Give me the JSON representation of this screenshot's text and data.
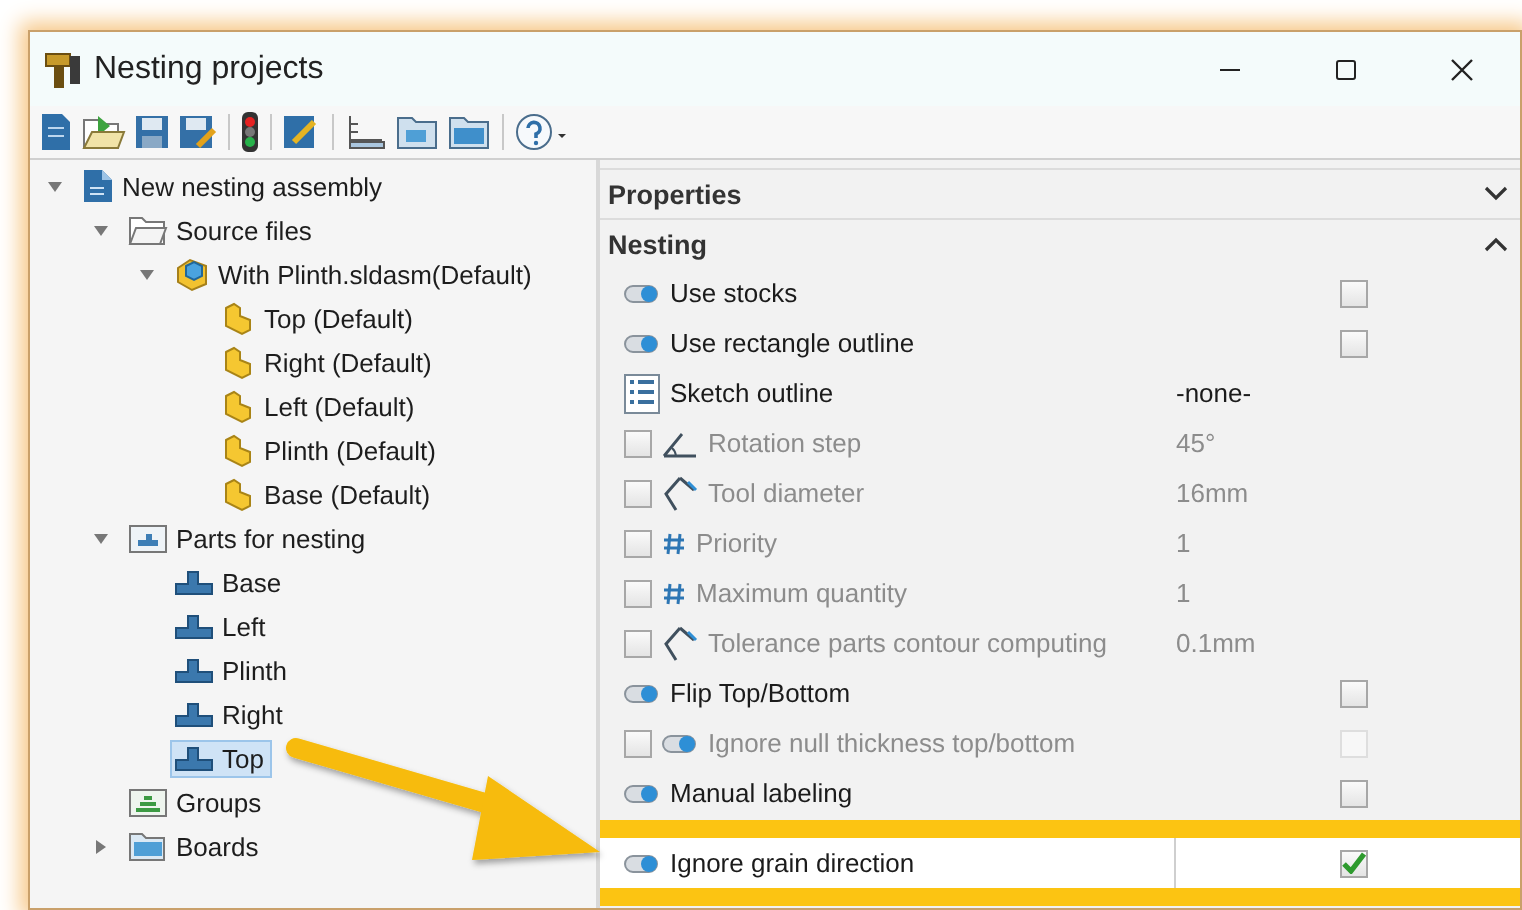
{
  "window": {
    "title": "Nesting projects"
  },
  "tree": [
    {
      "label": "New nesting assembly",
      "kind": "document",
      "expanded": true,
      "selected": false,
      "children": [
        {
          "label": "Source files",
          "kind": "folder",
          "expanded": true,
          "selected": false,
          "children": [
            {
              "label": "With Plinth.sldasm(Default)",
              "kind": "assembly",
              "expanded": true,
              "selected": false,
              "children": [
                {
                  "label": "Top (Default)",
                  "kind": "part",
                  "selected": false
                },
                {
                  "label": "Right (Default)",
                  "kind": "part",
                  "selected": false
                },
                {
                  "label": "Left (Default)",
                  "kind": "part",
                  "selected": false
                },
                {
                  "label": "Plinth (Default)",
                  "kind": "part",
                  "selected": false
                },
                {
                  "label": "Base (Default)",
                  "kind": "part",
                  "selected": false
                }
              ]
            }
          ]
        },
        {
          "label": "Parts for nesting",
          "kind": "parts-folder",
          "expanded": true,
          "selected": false,
          "children": [
            {
              "label": "Base",
              "kind": "nest-part",
              "selected": false
            },
            {
              "label": "Left",
              "kind": "nest-part",
              "selected": false
            },
            {
              "label": "Plinth",
              "kind": "nest-part",
              "selected": false
            },
            {
              "label": "Right",
              "kind": "nest-part",
              "selected": false
            },
            {
              "label": "Top",
              "kind": "nest-part",
              "selected": true
            }
          ]
        },
        {
          "label": "Groups",
          "kind": "groups-folder",
          "selected": false
        },
        {
          "label": "Boards",
          "kind": "boards-folder",
          "expanded": false,
          "selected": false
        }
      ]
    }
  ],
  "properties": {
    "sections": [
      {
        "title": "Properties",
        "expanded": false
      },
      {
        "title": "Nesting",
        "expanded": true,
        "rows": [
          {
            "kind": "switch",
            "label": "Use stocks",
            "checked": false,
            "disabled": false,
            "highlighted": false
          },
          {
            "kind": "switch",
            "label": "Use rectangle outline",
            "checked": false,
            "disabled": false,
            "highlighted": false
          },
          {
            "kind": "list",
            "label": "Sketch outline",
            "value": "-none-",
            "disabled": false,
            "highlighted": false
          },
          {
            "kind": "angle",
            "label": "Rotation step",
            "enabled": false,
            "value": "45°",
            "disabled": true,
            "highlighted": false
          },
          {
            "kind": "tool",
            "label": "Tool diameter",
            "enabled": false,
            "value": "16mm",
            "disabled": true,
            "highlighted": false
          },
          {
            "kind": "number",
            "label": "Priority",
            "enabled": false,
            "value": "1",
            "disabled": true,
            "highlighted": false
          },
          {
            "kind": "number",
            "label": "Maximum quantity",
            "enabled": false,
            "value": "1",
            "disabled": true,
            "highlighted": false
          },
          {
            "kind": "tool",
            "label": "Tolerance parts contour computing",
            "enabled": false,
            "value": "0.1mm",
            "disabled": true,
            "highlighted": false
          },
          {
            "kind": "switch",
            "label": "Flip Top/Bottom",
            "checked": false,
            "disabled": false,
            "highlighted": false
          },
          {
            "kind": "optional-switch",
            "label": "Ignore null thickness top/bottom",
            "enabled": false,
            "checked": false,
            "disabled": true,
            "highlighted": false
          },
          {
            "kind": "switch",
            "label": "Manual labeling",
            "checked": false,
            "disabled": false,
            "highlighted": false
          },
          {
            "kind": "switch",
            "label": "Ignore grain direction",
            "checked": true,
            "disabled": false,
            "highlighted": true
          }
        ]
      }
    ]
  }
}
